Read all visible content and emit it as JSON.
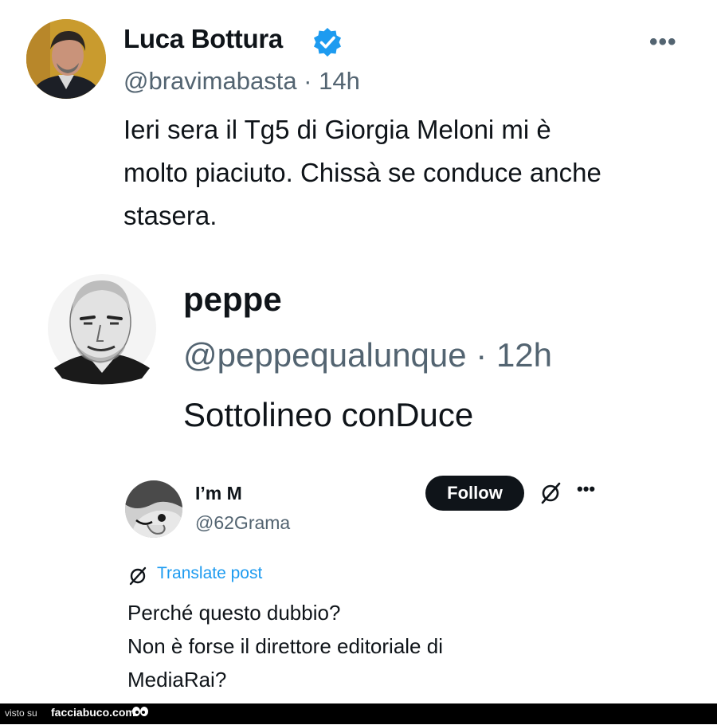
{
  "tweet1": {
    "author": "Luca Bottura",
    "handle": "@bravimabasta · 14h",
    "text": "Ieri sera il Tg5 di Giorgia Meloni mi è\nmolto piaciuto. Chissà se conduce anche\nstasera.",
    "more": "•••"
  },
  "tweet2": {
    "author": "peppe",
    "handle": "@peppequalunque · 12h",
    "text": "Sottolineo conDuce"
  },
  "tweet3": {
    "author": "I’m M",
    "handle": "@62Grama",
    "follow_label": "Follow",
    "more": "•••",
    "translate_label": "Translate post",
    "text": "Perché questo dubbio?\nNon è forse il direttore editoriale di\nMediaRai?"
  },
  "footer": {
    "visto": "visto su",
    "site": "facciabuco.com"
  },
  "colors": {
    "verified": "#1d9bf0",
    "link": "#1d9bf0",
    "muted": "#536471"
  }
}
